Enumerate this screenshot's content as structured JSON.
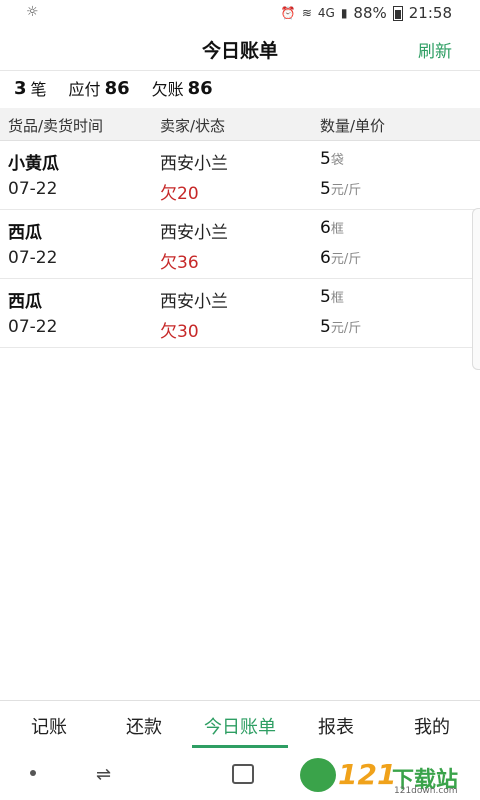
{
  "status_bar": {
    "signal_label": "4G",
    "battery_text": "88%",
    "time": "21:58"
  },
  "header": {
    "title": "今日账单",
    "refresh_label": "刷新"
  },
  "summary": {
    "count": "3",
    "count_unit": "笔",
    "due_label": "应付",
    "due_value": "86",
    "debt_label": "欠账",
    "debt_value": "86"
  },
  "table": {
    "headers": [
      "货品/卖货时间",
      "卖家/状态",
      "数量/单价"
    ],
    "rows": [
      {
        "item": "小黄瓜",
        "date": "07-22",
        "seller": "西安小兰",
        "status": "欠20",
        "qty": "5",
        "qty_unit": "袋",
        "price": "5",
        "price_unit": "元/斤"
      },
      {
        "item": "西瓜",
        "date": "07-22",
        "seller": "西安小兰",
        "status": "欠36",
        "qty": "6",
        "qty_unit": "框",
        "price": "6",
        "price_unit": "元/斤"
      },
      {
        "item": "西瓜",
        "date": "07-22",
        "seller": "西安小兰",
        "status": "欠30",
        "qty": "5",
        "qty_unit": "框",
        "price": "5",
        "price_unit": "元/斤"
      }
    ]
  },
  "tabs": [
    "记账",
    "还款",
    "今日账单",
    "报表",
    "我的"
  ],
  "active_tab": "今日账单",
  "watermark": {
    "number": "121",
    "text": "下载站",
    "url": "121down.com"
  },
  "colors": {
    "accent": "#2e9e63",
    "debt": "#c62828"
  }
}
